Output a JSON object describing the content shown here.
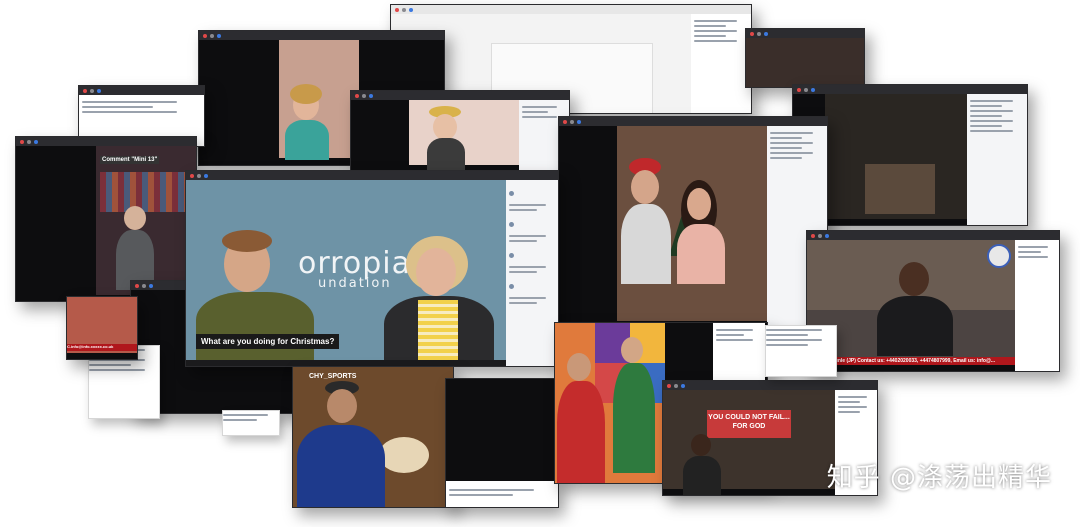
{
  "main_stream": {
    "logo_text": "orropia",
    "logo_sub": "undation",
    "caption": "What are you doing for Christmas?"
  },
  "left_stream": {
    "banner": "Comment \"Mini 13\""
  },
  "sports_stream": {
    "channel_tag": "CHY_SPORTS"
  },
  "church_stream": {
    "sign_text": "YOU COULD NOT FAIL... FOR GOD"
  },
  "pastor_stream": {
    "ticker": "Pastor Olakunle (JP) Contact us: +4402020033, +4474807999, Email us: info@..."
  },
  "tutorial_stream": {
    "ticker": "C.info@info.xxxxx.co.uk"
  },
  "watermark": "知乎 @涤荡出精华",
  "colors": {
    "teal_background": "#6e93a6",
    "ticker_red": "#b0171c",
    "accent_blue": "#3b79e0"
  }
}
